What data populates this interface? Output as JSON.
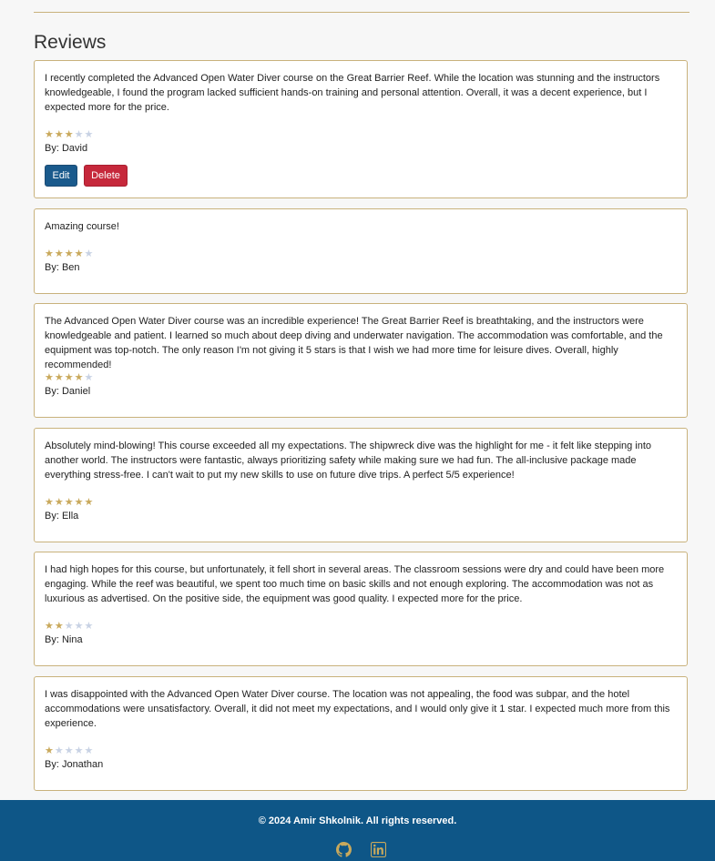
{
  "reviews_section": {
    "title": "Reviews"
  },
  "colors": {
    "accent": "#c9b27c",
    "star_on": "#c9a95c",
    "star_off": "#c8d2e4",
    "footer_bg": "#0e5687",
    "edit_button": "#1a5a8c",
    "delete_button": "#c6283b"
  },
  "reviews": [
    {
      "text": "I recently completed the Advanced Open Water Diver course on the Great Barrier Reef. While the location was stunning and the instructors knowledgeable, I found the program lacked sufficient hands-on training and personal attention. Overall, it was a decent experience, but I expected more for the price.",
      "rating": 3,
      "max_rating": 5,
      "author": "By: David",
      "edit_label": "Edit",
      "delete_label": "Delete"
    },
    {
      "text": "Amazing course!",
      "rating": 4,
      "max_rating": 5,
      "author": "By: Ben"
    },
    {
      "text": "The Advanced Open Water Diver course was an incredible experience! The Great Barrier Reef is breathtaking, and the instructors were knowledgeable and patient. I learned so much about deep diving and underwater navigation. The accommodation was comfortable, and the equipment was top-notch. The only reason I'm not giving it 5 stars is that I wish we had more time for leisure dives. Overall, highly recommended!",
      "rating": 4,
      "max_rating": 5,
      "author": "By: Daniel"
    },
    {
      "text": "Absolutely mind-blowing! This course exceeded all my expectations. The shipwreck dive was the highlight for me - it felt like stepping into another world. The instructors were fantastic, always prioritizing safety while making sure we had fun. The all-inclusive package made everything stress-free. I can't wait to put my new skills to use on future dive trips. A perfect 5/5 experience!",
      "rating": 5,
      "max_rating": 5,
      "author": "By: Ella"
    },
    {
      "text": "I had high hopes for this course, but unfortunately, it fell short in several areas. The classroom sessions were dry and could have been more engaging. While the reef was beautiful, we spent too much time on basic skills and not enough exploring. The accommodation was not as luxurious as advertised. On the positive side, the equipment was good quality. I expected more for the price.",
      "rating": 2,
      "max_rating": 5,
      "author": "By: Nina"
    },
    {
      "text": "I was disappointed with the Advanced Open Water Diver course. The location was not appealing, the food was subpar, and the hotel accommodations were unsatisfactory. Overall, it did not meet my expectations, and I would only give it 1 star. I expected much more from this experience.",
      "rating": 1,
      "max_rating": 5,
      "author": "By: Jonathan"
    }
  ],
  "footer": {
    "copyright": "© 2024 Amir Shkolnik. All rights reserved.",
    "icons": [
      "github-icon",
      "linkedin-icon"
    ]
  }
}
